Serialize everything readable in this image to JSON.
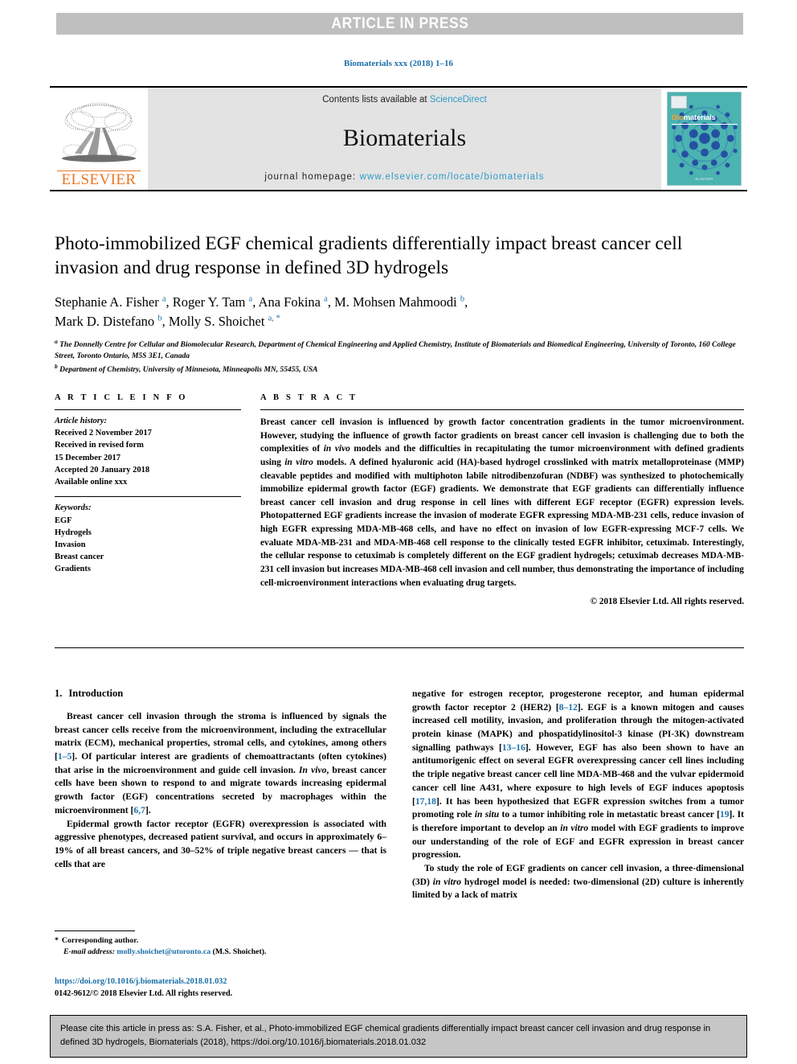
{
  "banner": {
    "text": "ARTICLE IN PRESS"
  },
  "journal_ref": "Biomaterials xxx (2018) 1–16",
  "masthead": {
    "contents_prefix": "Contents lists available at ",
    "contents_link": "ScienceDirect",
    "journal_name": "Biomaterials",
    "homepage_prefix": "journal homepage: ",
    "homepage_url": "www.elsevier.com/locate/biomaterials",
    "publisher": "ELSEVIER",
    "cover": {
      "title_part1": "Bio",
      "title_part2": "materials",
      "footer": "ELSEVIER"
    }
  },
  "article": {
    "title": "Photo-immobilized EGF chemical gradients differentially impact breast cancer cell invasion and drug response in defined 3D hydrogels",
    "authors_line1": "Stephanie A. Fisher <sup>a</sup>, Roger Y. Tam <sup>a</sup>, Ana Fokina <sup>a</sup>, M. Mohsen Mahmoodi <sup>b</sup>,",
    "authors_line2": "Mark D. Distefano <sup>b</sup>, Molly S. Shoichet <sup>a, *</sup>",
    "affiliation_a": "<sup>a</sup> The Donnelly Centre for Cellular and Biomolecular Research, Department of Chemical Engineering and Applied Chemistry, Institute of Biomaterials and Biomedical Engineering, University of Toronto, 160 College Street, Toronto Ontario, M5S 3E1, Canada",
    "affiliation_b": "<sup>b</sup> Department of Chemistry, University of Minnesota, Minneapolis MN, 55455, USA"
  },
  "article_info": {
    "label": "A R T I C L E  I N F O",
    "history_label": "Article history:",
    "history": [
      "Received 2 November 2017",
      "Received in revised form",
      "15 December 2017",
      "Accepted 20 January 2018",
      "Available online xxx"
    ],
    "keywords_label": "Keywords:",
    "keywords": [
      "EGF",
      "Hydrogels",
      "Invasion",
      "Breast cancer",
      "Gradients"
    ]
  },
  "abstract": {
    "label": "A B S T R A C T",
    "text": "Breast cancer cell invasion is influenced by growth factor concentration gradients in the tumor microenvironment. However, studying the influence of growth factor gradients on breast cancer cell invasion is challenging due to both the complexities of <i>in vivo</i> models and the difficulties in recapitulating the tumor microenvironment with defined gradients using <i>in vitro</i> models. A defined hyaluronic acid (HA)-based hydrogel crosslinked with matrix metalloproteinase (MMP) cleavable peptides and modified with multiphoton labile nitrodibenzofuran (NDBF) was synthesized to photochemically immobilize epidermal growth factor (EGF) gradients. We demonstrate that EGF gradients can differentially influence breast cancer cell invasion and drug response in cell lines with different EGF receptor (EGFR) expression levels. Photopatterned EGF gradients increase the invasion of moderate EGFR expressing MDA-MB-231 cells, reduce invasion of high EGFR expressing MDA-MB-468 cells, and have no effect on invasion of low EGFR-expressing MCF-7 cells. We evaluate MDA-MB-231 and MDA-MB-468 cell response to the clinically tested EGFR inhibitor, cetuximab. Interestingly, the cellular response to cetuximab is completely different on the EGF gradient hydrogels; cetuximab decreases MDA-MB-231 cell invasion but increases MDA-MB-468 cell invasion and cell number, thus demonstrating the importance of including cell-microenvironment interactions when evaluating drug targets.",
    "copyright": "© 2018 Elsevier Ltd. All rights reserved."
  },
  "introduction": {
    "number": "1.",
    "heading": "Introduction",
    "left_paragraphs": [
      "Breast cancer cell invasion through the stroma is influenced by signals the breast cancer cells receive from the microenvironment, including the extracellular matrix (ECM), mechanical properties, stromal cells, and cytokines, among others [<span class=\"cite\">1–5</span>]. Of particular interest are gradients of chemoattractants (often cytokines) that arise in the microenvironment and guide cell invasion. <i>In vivo</i>, breast cancer cells have been shown to respond to and migrate towards increasing epidermal growth factor (EGF) concentrations secreted by macrophages within the microenvironment [<span class=\"cite\">6,7</span>].",
      "Epidermal growth factor receptor (EGFR) overexpression is associated with aggressive phenotypes, decreased patient survival, and occurs in approximately 6–19% of all breast cancers, and 30–52% of triple negative breast cancers — that is cells that are"
    ],
    "right_paragraphs": [
      "negative for estrogen receptor, progesterone receptor, and human epidermal growth factor receptor 2 (HER2) [<span class=\"cite\">8–12</span>]. EGF is a known mitogen and causes increased cell motility, invasion, and proliferation through the mitogen-activated protein kinase (MAPK) and phospatidylinositol-3 kinase (PI-3K) downstream signalling pathways [<span class=\"cite\">13–16</span>]. However, EGF has also been shown to have an antitumorigenic effect on several EGFR overexpressing cancer cell lines including the triple negative breast cancer cell line MDA-MB-468 and the vulvar epidermoid cancer cell line A431, where exposure to high levels of EGF induces apoptosis [<span class=\"cite\">17,18</span>]. It has been hypothesized that EGFR expression switches from a tumor promoting role <i>in situ</i> to a tumor inhibiting role in metastatic breast cancer [<span class=\"cite\">19</span>]. It is therefore important to develop an <i>in vitro</i> model with EGF gradients to improve our understanding of the role of EGF and EGFR expression in breast cancer progression.",
      "To study the role of EGF gradients on cancer cell invasion, a three-dimensional (3D) <i>in vitro</i> hydrogel model is needed: two-dimensional (2D) culture is inherently limited by a lack of matrix"
    ]
  },
  "footnotes": {
    "corresponding_star": "*",
    "corresponding_text": "Corresponding author.",
    "email_label": "E-mail address:",
    "email": "molly.shoichet@utoronto.ca",
    "email_suffix": "(M.S. Shoichet).",
    "doi_url": "https://doi.org/10.1016/j.biomaterials.2018.01.032",
    "issn_line": "0142-9612/© 2018 Elsevier Ltd. All rights reserved."
  },
  "cite_footer": {
    "text": "Please cite this article in press as: S.A. Fisher, et al., Photo-immobilized EGF chemical gradients differentially impact breast cancer cell invasion and drug response in defined 3D hydrogels, Biomaterials (2018), https://doi.org/10.1016/j.biomaterials.2018.01.032"
  },
  "colors": {
    "link_blue": "#1a6fa8",
    "sciencedirect_blue": "#2e9bc8",
    "elsevier_orange": "#e87722",
    "banner_gray": "#bfbfbf",
    "masthead_gray": "#e3e3e3",
    "footer_gray": "#c6c6c6",
    "cover_teal": "#4bb3b0"
  }
}
